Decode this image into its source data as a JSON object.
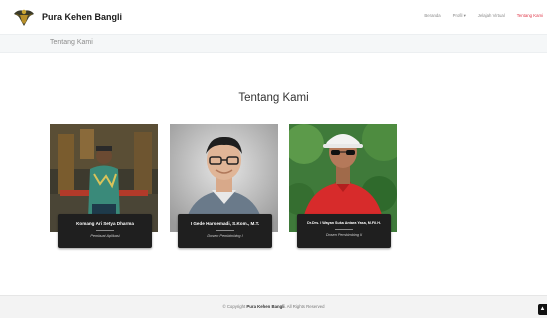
{
  "brand": {
    "name": "Pura Kehen Bangli",
    "logo_icon": "garuda-crest-icon"
  },
  "nav": {
    "items": [
      {
        "label": "Beranda",
        "active": false
      },
      {
        "label": "Profil ▾",
        "active": false
      },
      {
        "label": "Jelajah Virtual",
        "active": false
      },
      {
        "label": "Tentang Kami",
        "active": true
      }
    ],
    "active_color": "#e0394a"
  },
  "breadcrumb": {
    "title": "Tentang Kami"
  },
  "section": {
    "title": "Tentang Kami"
  },
  "members": [
    {
      "name": "Komang Ari Setya Dharma",
      "role": "Pembuat Aplikasi"
    },
    {
      "name": "I Gede Harsemadi, S.Kom., M.T.",
      "role": "Dosen Pembimbing I"
    },
    {
      "name": "Dr.Drs. I Wayan Suka Antara Yasa, M.Fil.H.",
      "role": "Dosen Pembimbing II"
    }
  ],
  "footer": {
    "prefix": "© Copyright",
    "brand": "Pura Kehen Bangli",
    "suffix": ". All Rights Reserved"
  },
  "back_to_top": {
    "icon": "arrow-up-icon"
  }
}
